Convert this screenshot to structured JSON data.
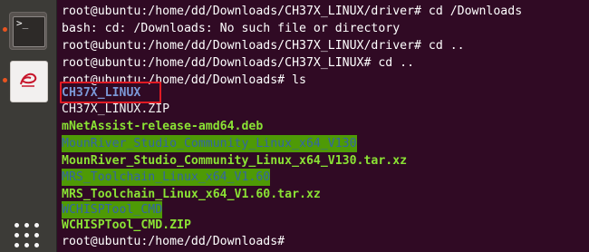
{
  "dock": {
    "items": [
      {
        "name": "terminal",
        "glyph": ">_"
      },
      {
        "name": "pdf-reader",
        "glyph": "e"
      }
    ],
    "accent": "#e95420"
  },
  "terminal": {
    "lines": [
      "root@ubuntu:/home/dd/Downloads/CH37X_LINUX/driver# cd /Downloads",
      "bash: cd: /Downloads: No such file or directory",
      "root@ubuntu:/home/dd/Downloads/CH37X_LINUX/driver# cd ..",
      "root@ubuntu:/home/dd/Downloads/CH37X_LINUX# cd ..",
      "root@ubuntu:/home/dd/Downloads# ls"
    ],
    "listing": [
      {
        "text": "CH37X_LINUX",
        "style": "dir-blue"
      },
      {
        "text": "CH37X_LINUX.ZIP",
        "style": "file-plain"
      },
      {
        "text": "mNetAssist-release-amd64.deb",
        "style": "exec-green"
      },
      {
        "text": "MounRiver_Studio_Community_Linux_x64_V130",
        "style": "dir-highlight"
      },
      {
        "text": "MounRiver_Studio_Community_Linux_x64_V130.tar.xz",
        "style": "exec-green"
      },
      {
        "text": "MRS_Toolchain_Linux_x64_V1.60",
        "style": "dir-highlight"
      },
      {
        "text": "MRS_Toolchain_Linux_x64_V1.60.tar.xz",
        "style": "exec-green"
      },
      {
        "text": "WCHISPTool_CMD",
        "style": "dir-highlight"
      },
      {
        "text": "WCHISPTool_CMD.ZIP",
        "style": "exec-green"
      }
    ],
    "final_prompt": "root@ubuntu:/home/dd/Downloads#",
    "colors": {
      "background": "#300a24",
      "directory": "#7b97d6",
      "executable": "#8ae234",
      "highlight_bg": "#4e9a06",
      "annotation_box": "#e01b24"
    }
  }
}
